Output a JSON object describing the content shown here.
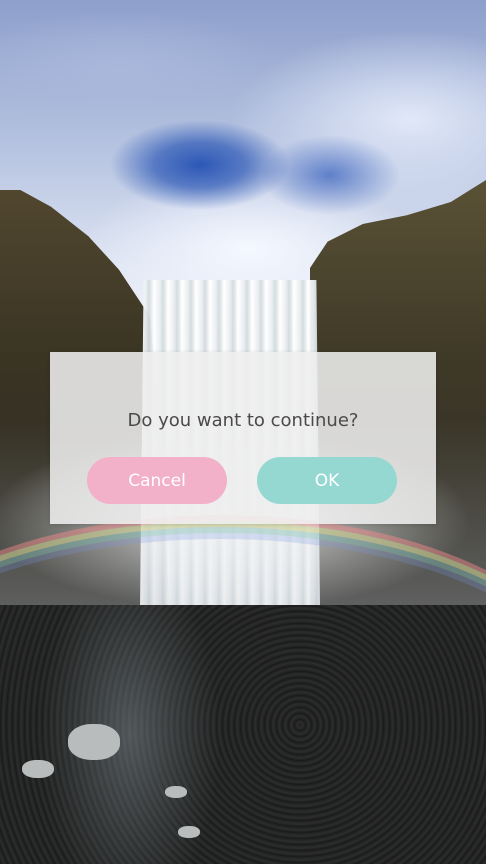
{
  "background": {
    "description_icon": "waterfall-photo"
  },
  "dialog": {
    "message": "Do you want to continue?",
    "cancel_label": "Cancel",
    "ok_label": "OK",
    "colors": {
      "panel": "#eeeeee",
      "message_text": "#4a4a4a",
      "cancel_button": "#f2b1c8",
      "ok_button": "#95d8d2",
      "button_text": "#ffffff"
    }
  }
}
